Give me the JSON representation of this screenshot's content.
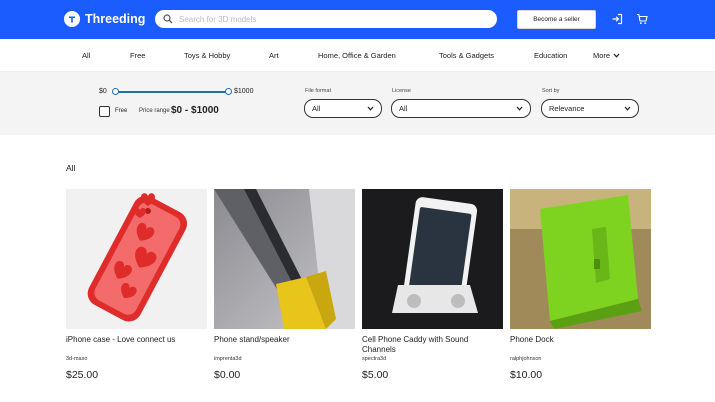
{
  "header": {
    "brand": "Threeding",
    "search_placeholder": "Search for 3D models",
    "seller_button": "Become a seller",
    "accent": "#1a5cff"
  },
  "nav": {
    "categories": [
      "All",
      "Free",
      "Toys & Hobby",
      "Art",
      "Home, Office & Garden",
      "Tools & Gadgets",
      "Education"
    ],
    "more_label": "More"
  },
  "filters": {
    "price_min": "$0",
    "price_max": "$1000",
    "free_label": "Free",
    "free_checked": false,
    "price_range_label": "Price range :",
    "price_range_value": "$0 - $1000",
    "file_format": {
      "label": "File format",
      "value": "All"
    },
    "license": {
      "label": "License",
      "value": "All"
    },
    "sort_by": {
      "label": "Sort by",
      "value": "Relevance"
    }
  },
  "section_title": "All",
  "products": [
    {
      "title": "iPhone case - Love connect us",
      "author": "3d-maxo",
      "price": "$25.00",
      "image": "red-phone-case"
    },
    {
      "title": "Phone stand/speaker",
      "author": "imprenta3d",
      "price": "$0.00",
      "image": "yellow-phone-stand"
    },
    {
      "title": "Cell Phone Caddy with Sound Channels",
      "author": "spectra3d",
      "price": "$5.00",
      "image": "white-phone-caddy"
    },
    {
      "title": "Phone Dock",
      "author": "ralphjohnson",
      "price": "$10.00",
      "image": "green-phone-dock"
    }
  ]
}
